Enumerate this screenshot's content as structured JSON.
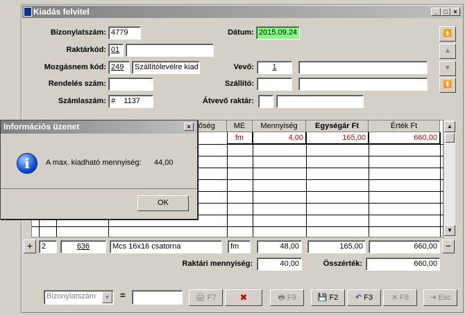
{
  "window": {
    "title": "Kiadás felvitel",
    "min": "_",
    "max": "□",
    "close": "×"
  },
  "form": {
    "bizonylatszam_label": "Bizonylatszám:",
    "bizonylatszam": "4779",
    "datum_label": "Dátum:",
    "datum": "2015.09.24",
    "raktarkod_label": "Raktárkód:",
    "raktarkod": "01",
    "raktarkod_name": "",
    "mozgasnem_label": "Mozgásnem kód:",
    "mozgasnem_kod": "249",
    "mozgasnem_name": "Szállítólevélre kiad",
    "vevo_label": "Vevő:",
    "vevo_kod": "1",
    "vevo_name": "",
    "rendeles_label": "Rendelés szám:",
    "rendeles": "",
    "szallito_label": "Szállító:",
    "szallito_kod": "",
    "szallito_name": "",
    "szamlaszam_label": "Számlaszám:",
    "szamlaszam": "#    1137",
    "atvevo_label": "Átvevő raktár:",
    "atvevo_kod": "",
    "atvevo_name": ""
  },
  "grid": {
    "headers": [
      "őség",
      "ME",
      "Mennyiség",
      "Egységár Ft",
      "Érték Ft"
    ],
    "row1": {
      "me": "fm",
      "mennyiseg": "4,00",
      "egysegar": "165,00",
      "ertek": "660,00"
    }
  },
  "entry": {
    "plus": "+",
    "sor": "2",
    "cikkszam": "636",
    "megnevezes": "Mcs 16x16 csatorna",
    "me": "fm",
    "mennyiseg": "48,00",
    "egysegar": "165,00",
    "ertek": "660,00",
    "minus": "−"
  },
  "summary": {
    "raktari_label": "Raktári mennyiség:",
    "raktari": "40,00",
    "osszertek_label": "Összérték:",
    "osszertek": "660,00"
  },
  "bottom": {
    "search_select": "Bizonylatszám",
    "eq": "=",
    "search_value": "",
    "f7": "F7",
    "f9": "F9",
    "f2": "F2",
    "f3": "F3",
    "f8": "F8",
    "esc": "Esc"
  },
  "dialog": {
    "title": "Információs üzenet",
    "close": "×",
    "icon": "i",
    "message": "A max. kiadható mennyiség:",
    "value": "44,00",
    "ok": "OK"
  },
  "colors": {
    "datum_bg": "#80ff80",
    "grid_text": "#c00000"
  }
}
